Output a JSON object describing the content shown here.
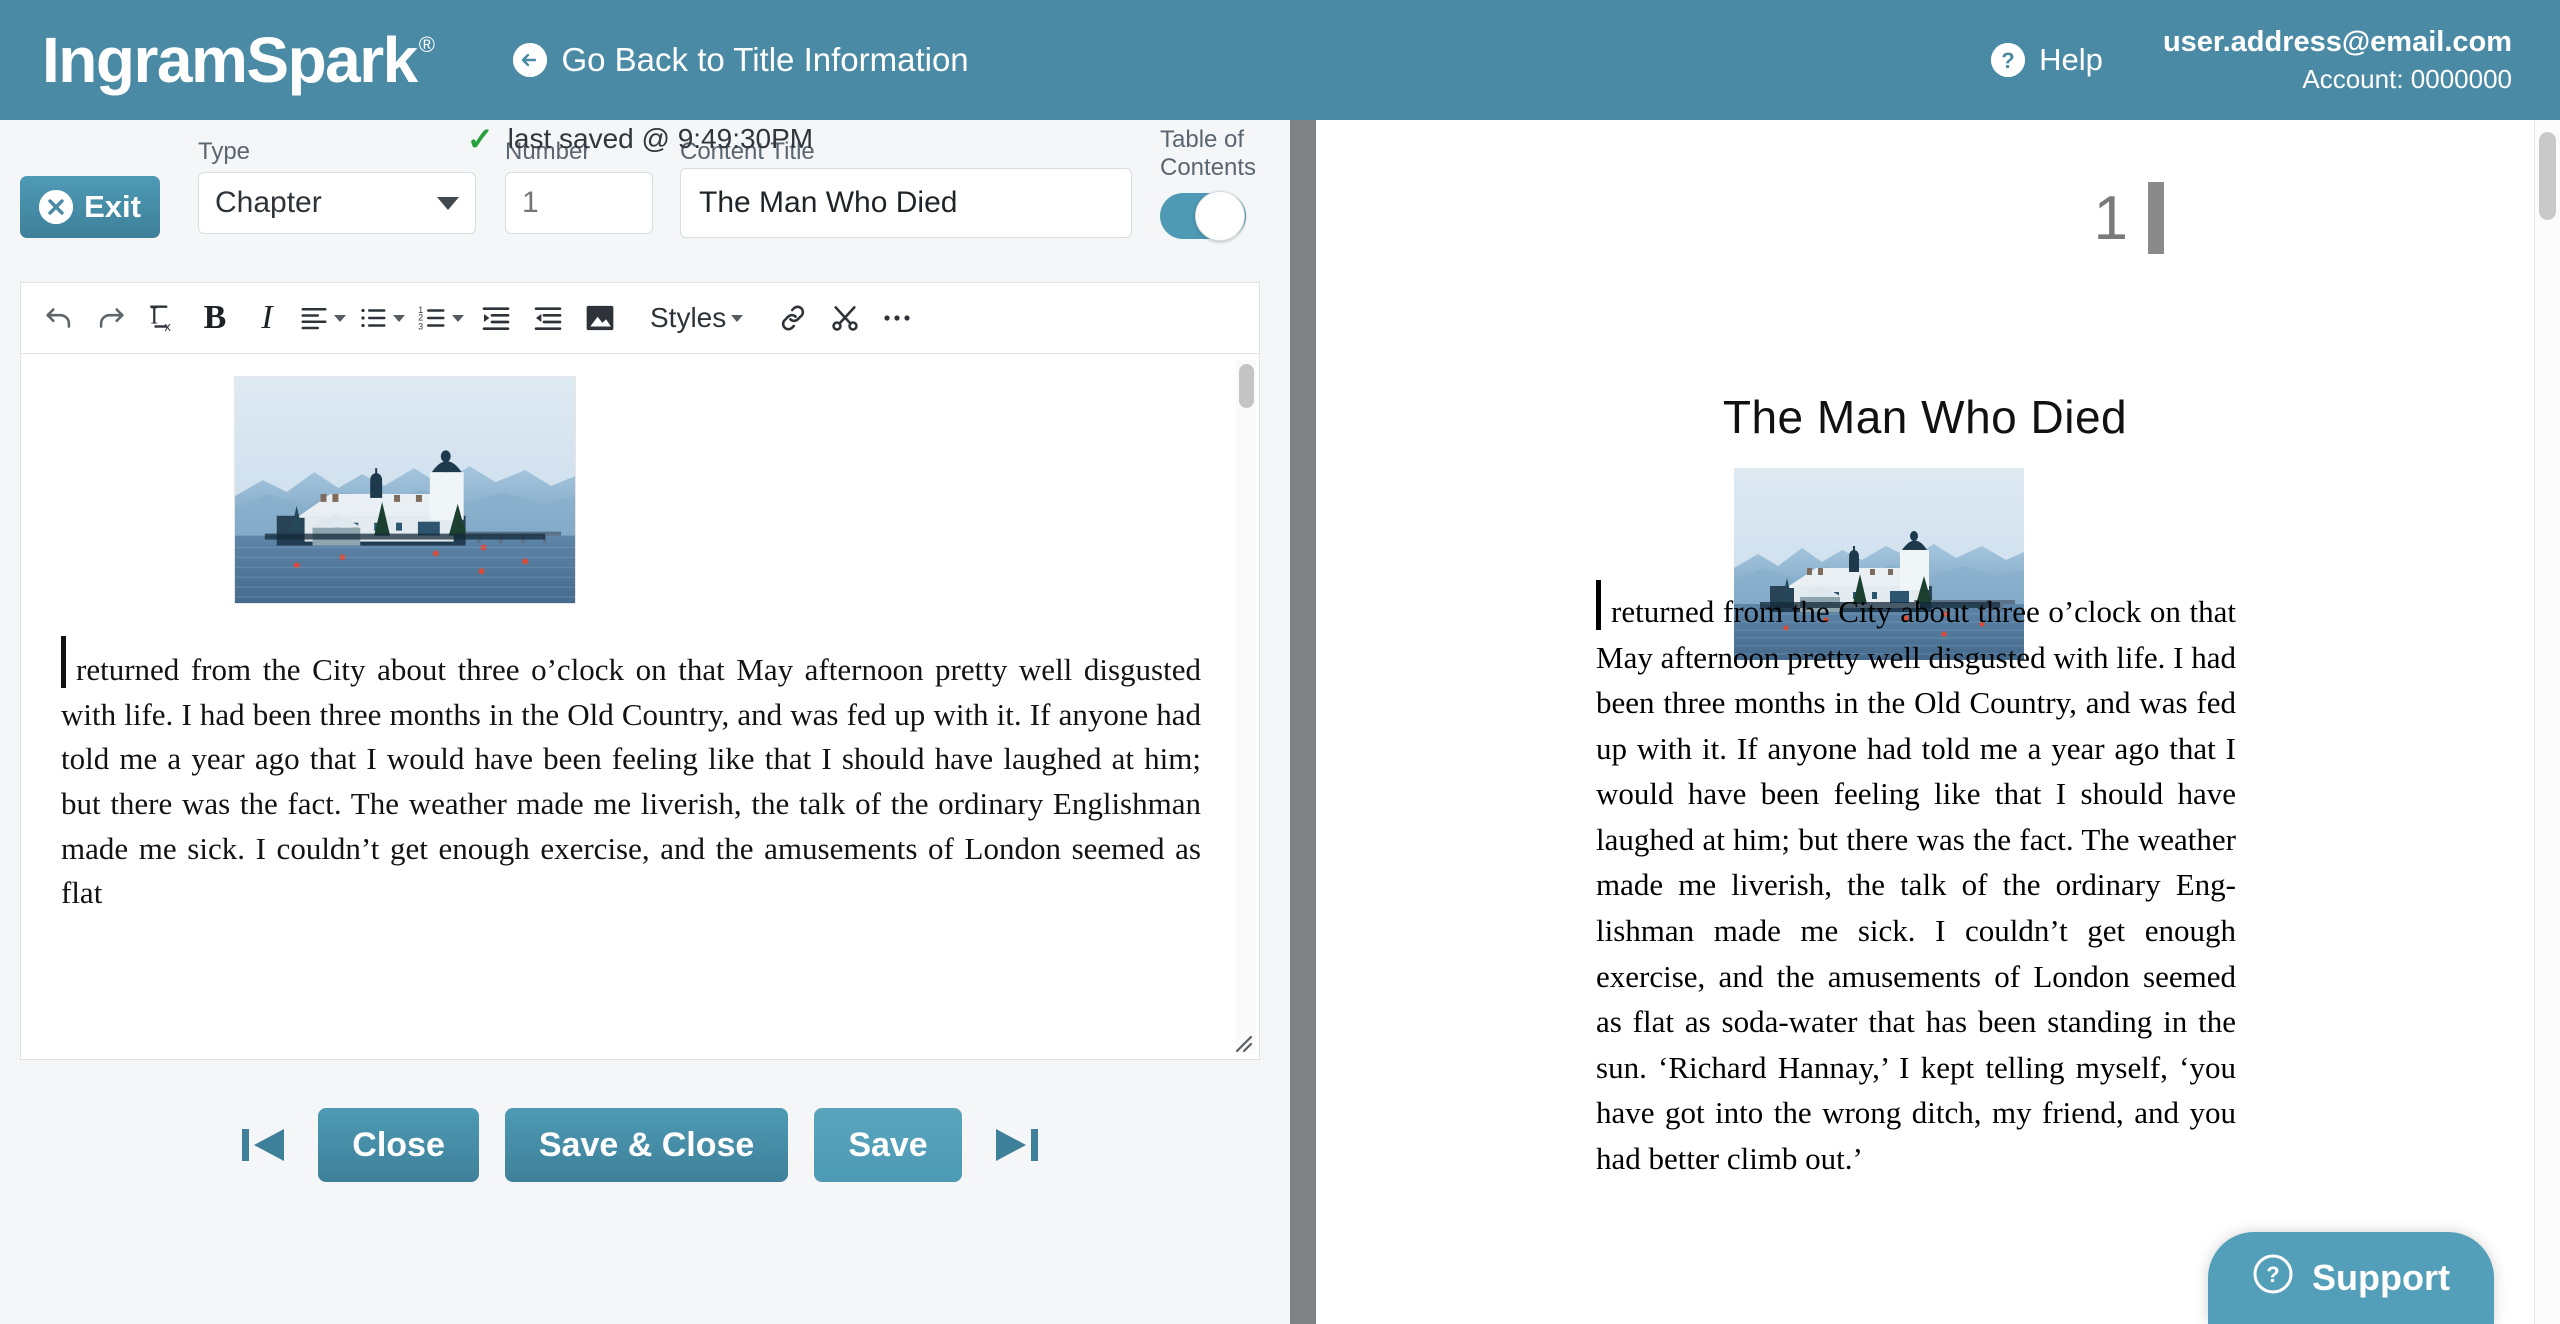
{
  "header": {
    "logo_text": "IngramSpark",
    "logo_reg": "®",
    "back_link": "Go Back to Title Information",
    "back_icon": "arrow-left-circle-icon",
    "help_label": "Help",
    "help_icon": "question-circle-icon",
    "email": "user.address@email.com",
    "account": "Account: 0000000"
  },
  "form": {
    "exit_label": "Exit",
    "exit_icon": "x-circle-icon",
    "type_label": "Type",
    "type_value": "Chapter",
    "number_label": "Number",
    "number_value": "",
    "number_placeholder": "1",
    "content_title_label": "Content Title",
    "content_title_value": "The Man Who Died",
    "toc_label": "Table of\nContents",
    "toc_label_line1": "Table of",
    "toc_label_line2": "Contents",
    "toc_state": "on"
  },
  "toolbar": {
    "items": [
      {
        "name": "undo-icon",
        "label": ""
      },
      {
        "name": "redo-icon",
        "label": ""
      },
      {
        "name": "remove-format-icon",
        "label": ""
      },
      {
        "name": "bold-icon",
        "label": "B"
      },
      {
        "name": "italic-icon",
        "label": "I"
      },
      {
        "name": "align-icon",
        "label": ""
      },
      {
        "name": "bullet-list-icon",
        "label": ""
      },
      {
        "name": "numbered-list-icon",
        "label": ""
      },
      {
        "name": "indent-increase-icon",
        "label": ""
      },
      {
        "name": "indent-decrease-icon",
        "label": ""
      },
      {
        "name": "image-icon",
        "label": ""
      },
      {
        "name": "styles-menu",
        "label": "Styles"
      },
      {
        "name": "link-icon",
        "label": ""
      },
      {
        "name": "scissors-icon",
        "label": ""
      },
      {
        "name": "more-options-icon",
        "label": ""
      }
    ],
    "styles_label": "Styles"
  },
  "editor": {
    "image_alt": "lakeside-castle-photo",
    "body_text": "returned from the City about three o’clock on that May afternoon pretty well disgusted with life. I had been three months in the Old Country, and was fed up with it. If anyone had told me a year ago that I would have been feeling like that I should have laughed at him; but there was the fact. The weather made me liverish, the talk of the ordinary Englishman made me sick. I couldn’t get enough exercise, and the amusements of London seemed as flat"
  },
  "actions": {
    "prev_icon": "skip-previous-icon",
    "close_label": "Close",
    "save_close_label": "Save & Close",
    "save_label": "Save",
    "next_icon": "skip-next-icon",
    "saved_check": "✓",
    "saved_text": "last saved @ 9:49:30PM"
  },
  "preview": {
    "page_number": "1",
    "chapter_title": "The Man Who Died",
    "image_alt": "lakeside-castle-photo",
    "body_text": "returned from the City about three o’clock on that May afternoon pretty well disgusted with life. I had been three months in the Old Country, and was fed up with it. If anyone had told me a year ago that I would have been feeling like that I should have laughed at him; but there was the fact. The weather made me liverish, the talk of the ordinary Eng­lishman made me sick. I couldn’t get enough exercise, and the amuse­ments of London seemed as flat as soda-water that has been standing in the sun. ‘Richard Hannay,’ I kept telling myself, ‘you have got into the wrong ditch, my friend, and you had better climb out.’"
  },
  "support": {
    "label": "Support",
    "icon": "question-circle-icon"
  },
  "colors": {
    "brand_teal": "#4a8aa5",
    "button_teal": "#4e9ab5",
    "divider_gray": "#7f8285",
    "panel_bg": "#f4f6f8",
    "label_gray": "#5b6670",
    "check_green": "#27a03a"
  }
}
